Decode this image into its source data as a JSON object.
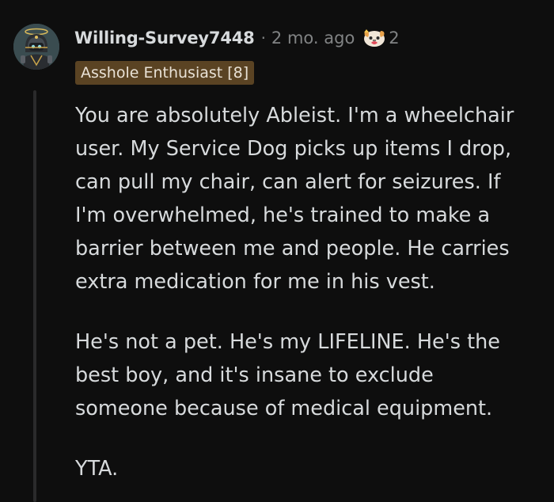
{
  "comment": {
    "author": "Willing-Survey7448",
    "separator": "·",
    "timestamp": "2 mo. ago",
    "award": {
      "icon": "wholesome-seal-award-icon",
      "count": "2"
    },
    "flair": "Asshole Enthusiast [8]",
    "avatar_icon": "user-avatar-robot-icon",
    "paragraphs": [
      {
        "lines": [
          "You are absolutely Ableist. I'm a wheelchair",
          "user. My Service Dog picks up items I drop,",
          "can pull my chair, can alert for seizures. If",
          "I'm overwhelmed, he's trained to make a",
          "barrier between me and people. He carries",
          "extra medication for me in his vest."
        ]
      },
      {
        "lines": [
          "He's not a pet. He's my LIFELINE. He's the",
          "best boy, and it's insane to exclude",
          "someone because of medical equipment."
        ]
      },
      {
        "lines": [
          "YTA."
        ]
      }
    ]
  },
  "colors": {
    "background": "#0e0e0e",
    "text": "#d7dadc",
    "muted": "#818384",
    "flair_bg": "#5a4323",
    "thread_line": "#2a2a2b"
  }
}
